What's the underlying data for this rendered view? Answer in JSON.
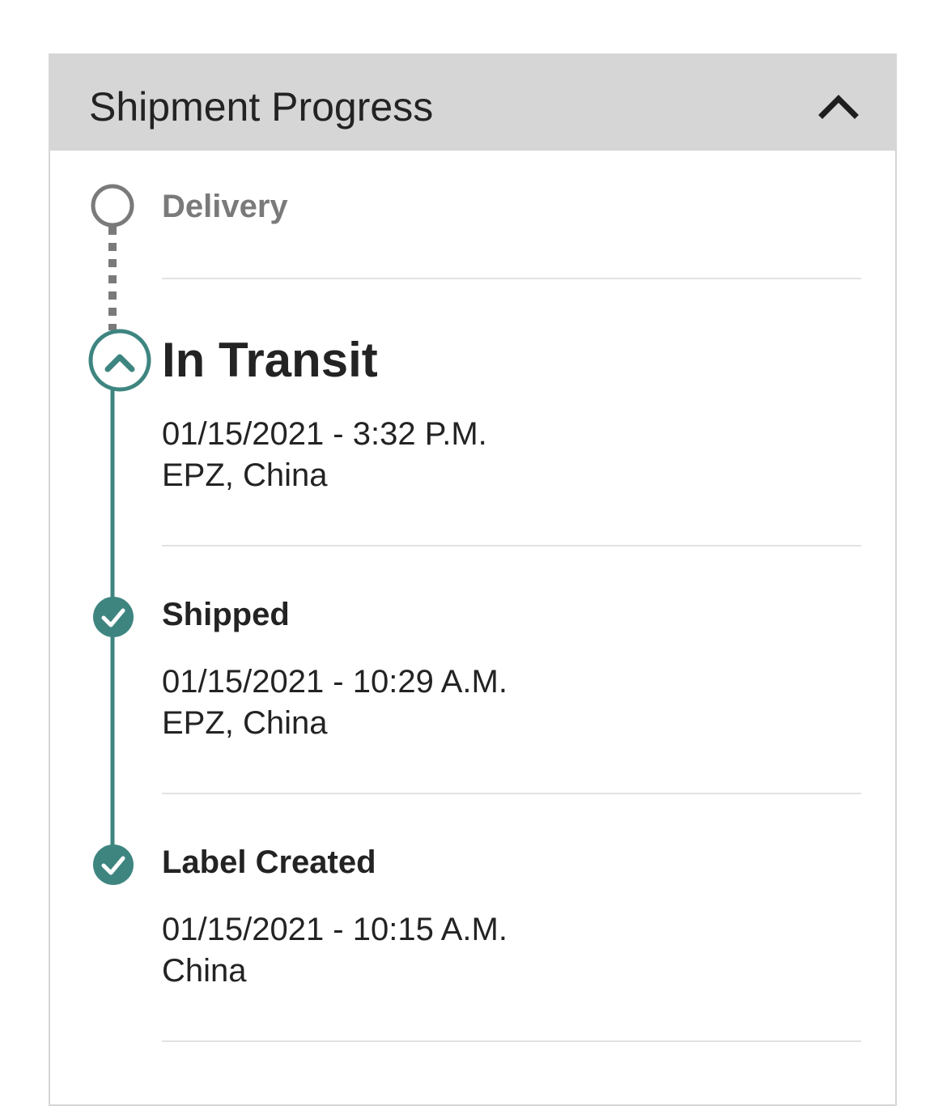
{
  "panel": {
    "title": "Shipment Progress",
    "collapse_icon": "chevron-up-icon"
  },
  "colors": {
    "accent": "#3e8580",
    "pending": "#7a7a7a",
    "header_bg": "#d6d6d6"
  },
  "steps": [
    {
      "label": "Delivery",
      "status": "pending",
      "icon": "empty-circle-icon"
    },
    {
      "label": "In Transit",
      "status": "current",
      "icon": "chevron-up-circle-icon",
      "datetime": "01/15/2021 - 3:32 P.M.",
      "location": "EPZ, China"
    },
    {
      "label": "Shipped",
      "status": "complete",
      "icon": "check-circle-icon",
      "datetime": "01/15/2021 - 10:29 A.M.",
      "location": "EPZ, China"
    },
    {
      "label": "Label Created",
      "status": "complete",
      "icon": "check-circle-icon",
      "datetime": "01/15/2021 - 10:15 A.M.",
      "location": "China"
    }
  ]
}
